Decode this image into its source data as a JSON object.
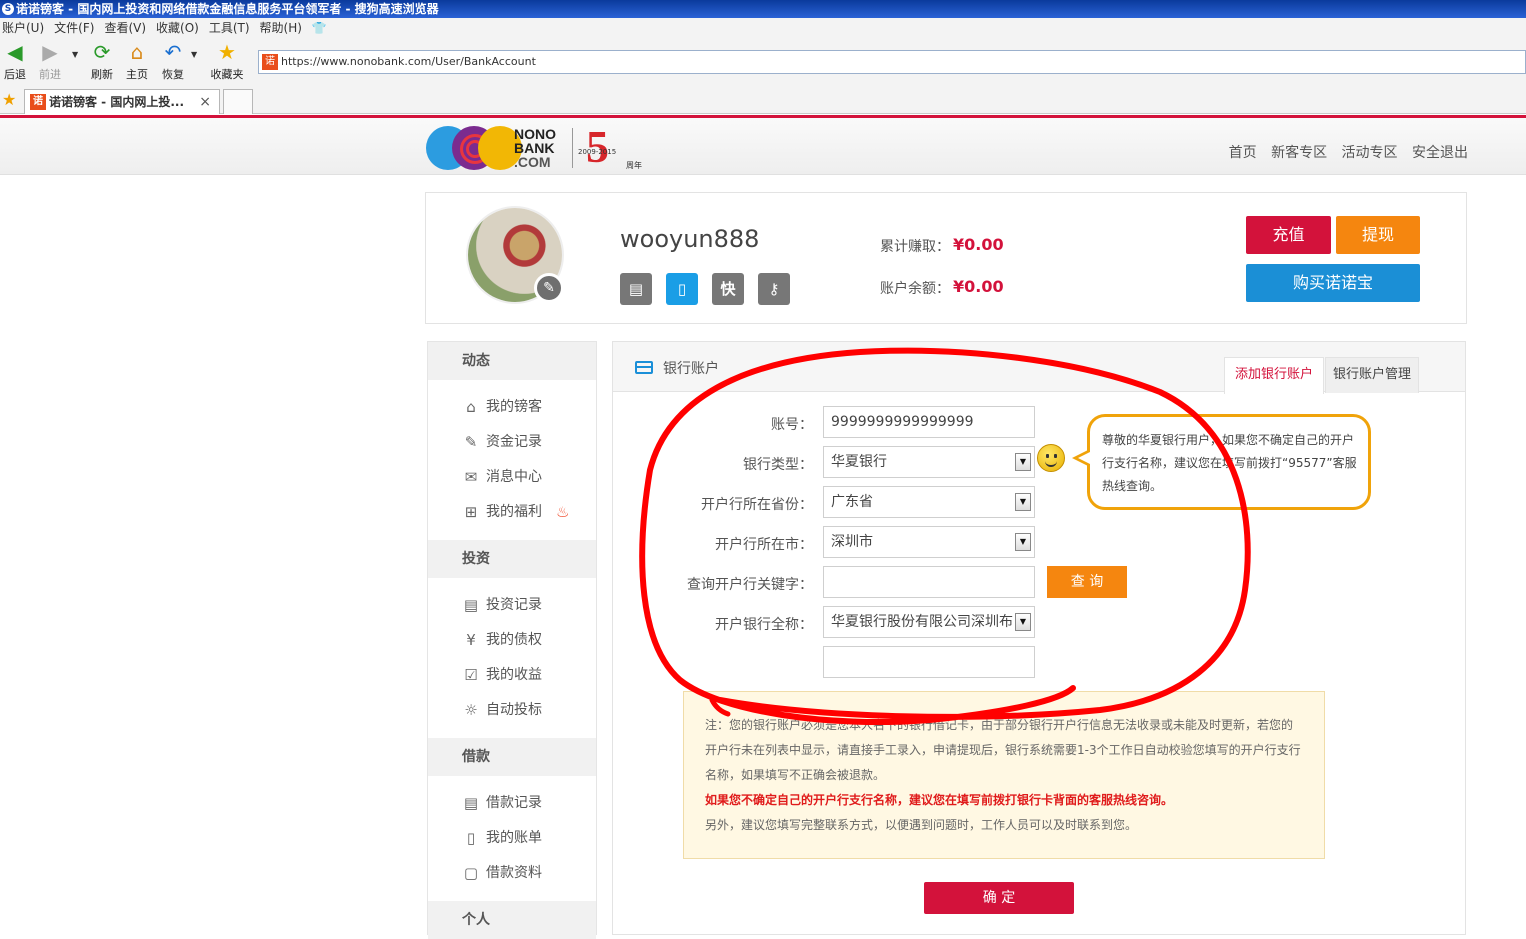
{
  "browser": {
    "title": "诺诺镑客 - 国内网上投资和网络借款金融信息服务平台领军者 - 搜狗高速浏览器",
    "menu": [
      "账户(U)",
      "文件(F)",
      "查看(V)",
      "收藏(O)",
      "工具(T)",
      "帮助(H)"
    ],
    "toolbar": {
      "back": "后退",
      "forward": "前进",
      "refresh": "刷新",
      "home": "主页",
      "restore": "恢复",
      "favorites": "收藏夹"
    },
    "address": "https://www.nonobank.com/User/BankAccount",
    "favicon_text": "诺",
    "tab_title": "诺诺镑客 - 国内网上投...",
    "tab_close": "×"
  },
  "site": {
    "logo": {
      "line1": "NONO",
      "line2": "BANK",
      "line3": ".COM",
      "anniversary_digit": "5",
      "years": "2009-2015",
      "anniversary_suffix": "周年"
    },
    "nav": [
      "首页",
      "新客专区",
      "活动专区",
      "安全退出"
    ]
  },
  "profile": {
    "username": "wooyun888",
    "badges": [
      {
        "icon": "id-card-icon",
        "text": "▤"
      },
      {
        "icon": "phone-icon",
        "text": "▯"
      },
      {
        "icon": "quick-pay-icon",
        "text": "快"
      },
      {
        "icon": "key-icon",
        "text": "⚷"
      }
    ],
    "total_earned_label": "累计赚取：",
    "total_earned": "¥0.00",
    "balance_label": "账户余额：",
    "balance": "¥0.00",
    "recharge": "充值",
    "withdraw": "提现",
    "buy": "购买诺诺宝"
  },
  "sidebar": {
    "sections": [
      {
        "title": "动态",
        "items": [
          {
            "label": "我的镑客",
            "icon": "⌂"
          },
          {
            "label": "资金记录",
            "icon": "✎"
          },
          {
            "label": "消息中心",
            "icon": "✉"
          },
          {
            "label": "我的福利",
            "icon": "⊞"
          }
        ]
      },
      {
        "title": "投资",
        "items": [
          {
            "label": "投资记录",
            "icon": "▤"
          },
          {
            "label": "我的债权",
            "icon": "¥"
          },
          {
            "label": "我的收益",
            "icon": "☑"
          },
          {
            "label": "自动投标",
            "icon": "☼"
          }
        ]
      },
      {
        "title": "借款",
        "items": [
          {
            "label": "借款记录",
            "icon": "▤"
          },
          {
            "label": "我的账单",
            "icon": "▯"
          },
          {
            "label": "借款资料",
            "icon": "▢"
          }
        ]
      },
      {
        "title": "个人",
        "items": []
      }
    ],
    "hot_icon": "♨"
  },
  "panel": {
    "title": "银行账户",
    "tabs": [
      "添加银行账户",
      "银行账户管理"
    ],
    "form": {
      "account_label": "账号：",
      "account_value": "9999999999999999",
      "bank_type_label": "银行类型：",
      "bank_type_value": "华夏银行",
      "province_label": "开户行所在省份：",
      "province_value": "广东省",
      "city_label": "开户行所在市：",
      "city_value": "深圳市",
      "keyword_label": "查询开户行关键字：",
      "keyword_value": "",
      "query_button": "查 询",
      "full_name_label": "开户银行全称：",
      "full_name_value": "华夏银行股份有限公司深圳布",
      "extra_value": ""
    },
    "tip": "尊敬的华夏银行用户，如果您不确定自己的开户行支行名称，建议您在填写前拨打“95577”客服热线查询。",
    "notice": {
      "line1": "注：您的银行账户必须是您本人名下的银行借记卡，由于部分银行开户行信息无法收录或未能及时更新，若您的开户行未在列表中显示，请直接手工录入，申请提现后，银行系统需要1-3个工作日自动校验您填写的开户行支行名称，如果填写不正确会被退款。",
      "line2": "如果您不确定自己的开户行支行名称，建议您在填写前拨打银行卡背面的客服热线咨询。",
      "line3": "另外，建议您填写完整联系方式，以便遇到问题时，工作人员可以及时联系到您。"
    },
    "confirm": "确 定"
  },
  "colors": {
    "brand_red": "#d3123b",
    "orange": "#f5860f",
    "blue": "#1b8fd6",
    "annotation": "#ff0000"
  }
}
